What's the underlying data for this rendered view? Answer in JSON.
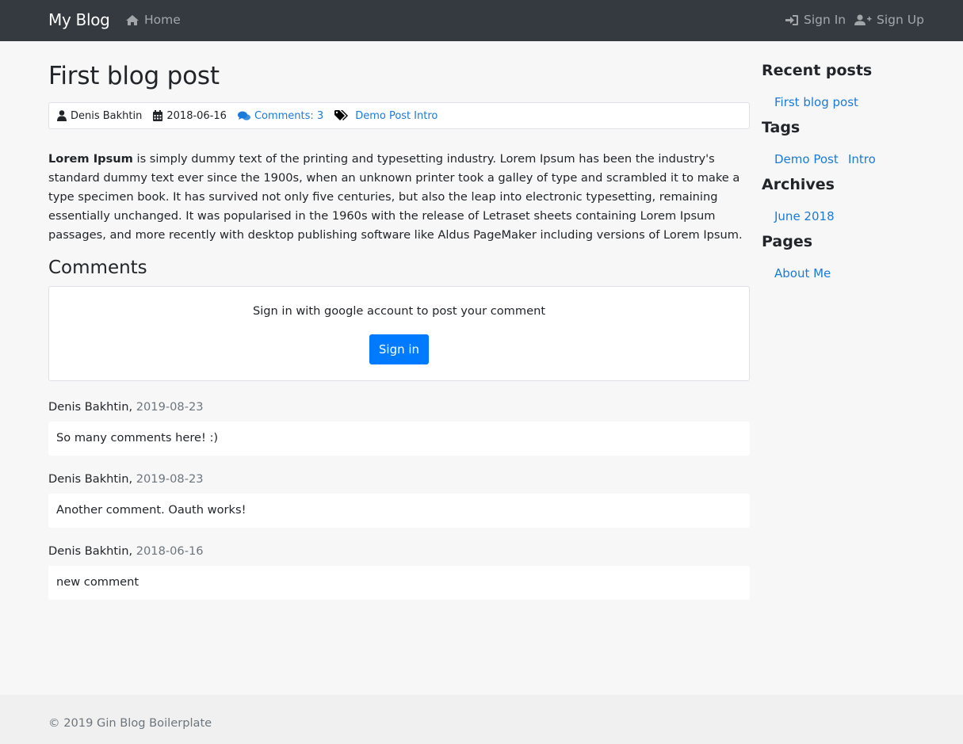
{
  "navbar": {
    "brand": "My Blog",
    "home_label": "Home",
    "signin_label": "Sign In",
    "signup_label": "Sign Up"
  },
  "post": {
    "title": "First blog post",
    "author": "Denis Bakhtin",
    "date": "2018-06-16",
    "comments_label": "Comments: 3",
    "tags": [
      "Demo Post",
      "Intro"
    ],
    "body_bold": "Lorem Ipsum",
    "body_rest": " is simply dummy text of the printing and typesetting industry. Lorem Ipsum has been the industry's standard dummy text ever since the 1900s, when an unknown printer took a galley of type and scrambled it to make a type specimen book. It has survived not only five centuries, but also the leap into electronic typesetting, remaining essentially unchanged. It was popularised in the 1960s with the release of Letraset sheets containing Lorem Ipsum passages, and more recently with desktop publishing software like Aldus PageMaker including versions of Lorem Ipsum."
  },
  "comments_section": {
    "heading": "Comments",
    "signin_prompt": "Sign in with google account to post your comment",
    "signin_button": "Sign in",
    "items": [
      {
        "author": "Denis Bakhtin",
        "date": "2019-08-23",
        "text": "So many comments here! :)"
      },
      {
        "author": "Denis Bakhtin",
        "date": "2019-08-23",
        "text": "Another comment. Oauth works!"
      },
      {
        "author": "Denis Bakhtin",
        "date": "2018-06-16",
        "text": "new comment"
      }
    ]
  },
  "sidebar": {
    "recent_heading": "Recent posts",
    "recent_items": [
      "First blog post"
    ],
    "tags_heading": "Tags",
    "tags_items": [
      "Demo Post",
      "Intro"
    ],
    "archives_heading": "Archives",
    "archives_items": [
      "June 2018"
    ],
    "pages_heading": "Pages",
    "pages_items": [
      "About Me"
    ]
  },
  "footer": {
    "text": "© 2019 Gin Blog Boilerplate"
  },
  "colors": {
    "navbar_bg": "#343a40",
    "link": "#1a7ad9",
    "primary_button": "#007bff",
    "page_bg": "#f7f7f7"
  }
}
